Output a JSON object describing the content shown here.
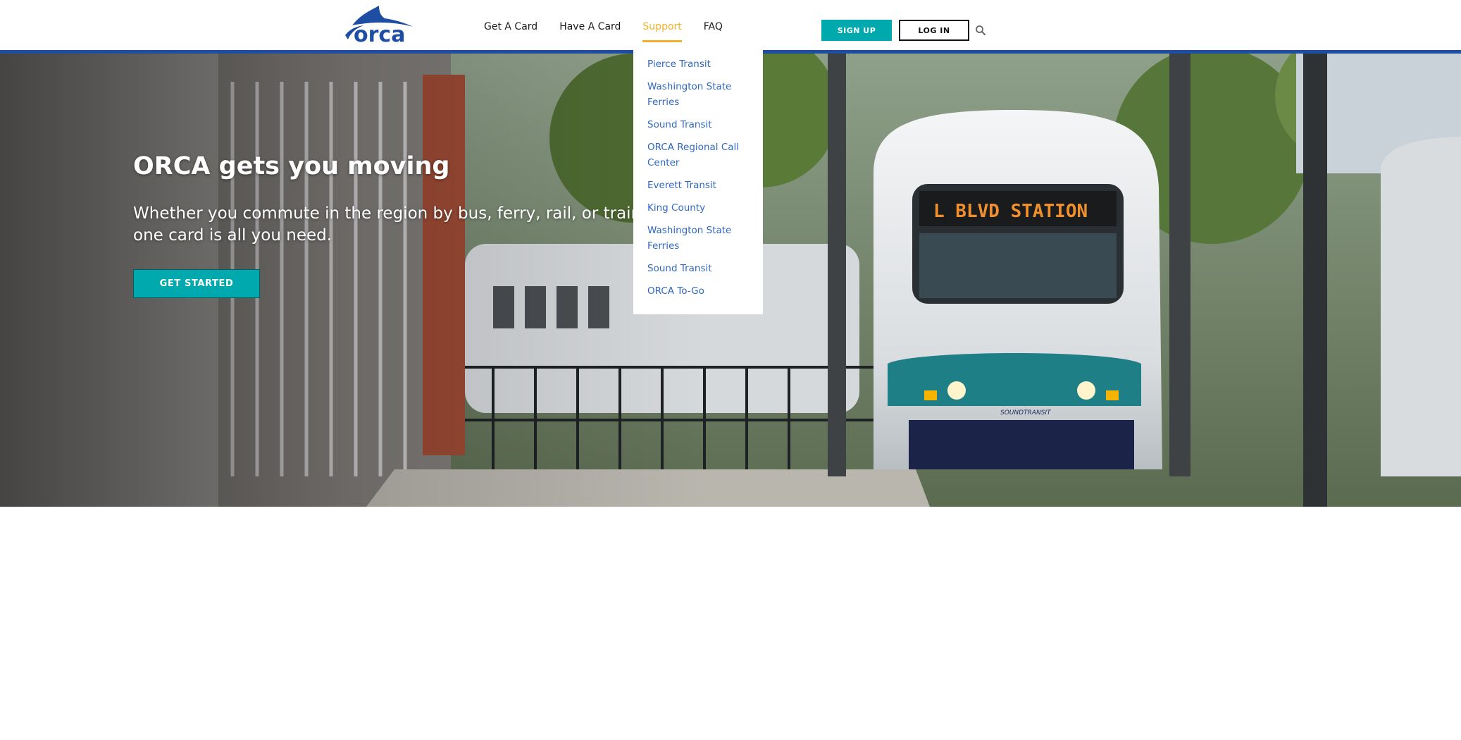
{
  "header": {
    "logo_text": "orca",
    "nav": [
      "Get A Card",
      "Have A Card",
      "Support",
      "FAQ"
    ],
    "active_nav": "Support",
    "signup_label": "SIGN UP",
    "login_label": "LOG IN"
  },
  "support_menu": {
    "items": [
      "Pierce Transit",
      "Washington State Ferries",
      "Sound Transit",
      "ORCA Regional Call Center",
      "Everett Transit",
      "King County",
      "Washington State Ferries",
      "Sound Transit",
      "ORCA To-Go"
    ]
  },
  "hero": {
    "title": "ORCA gets you moving",
    "subtitle": "Whether you commute in the region by bus, ferry, rail, or train - one card is all you need.",
    "cta_label": "GET STARTED",
    "train_sign": "L BLVD STATION",
    "train_brand": "SOUNDTRANSIT"
  },
  "colors": {
    "brand_blue": "#1e4ea3",
    "accent_teal": "#00a9ae",
    "active_yellow": "#f2b12b",
    "link_blue": "#3068c2"
  },
  "icons": {
    "search": "search-icon",
    "logo": "orca-logo"
  }
}
